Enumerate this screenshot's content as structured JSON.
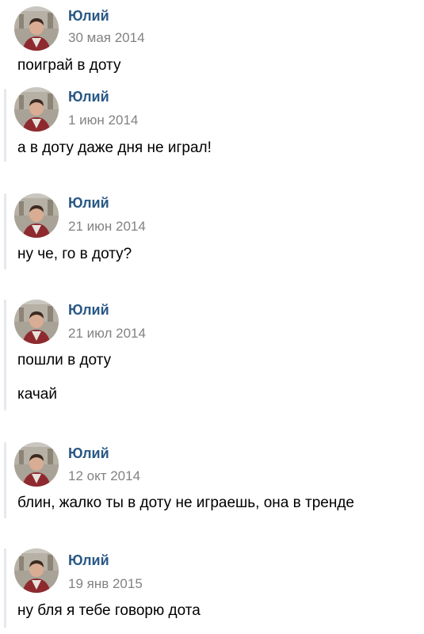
{
  "messages": [
    {
      "author": "Юлий",
      "date": "30 мая 2014",
      "lines": [
        "поиграй в доту"
      ]
    },
    {
      "author": "Юлий",
      "date": "1 июн 2014",
      "lines": [
        "а в доту даже дня не играл!"
      ]
    },
    {
      "author": "Юлий",
      "date": "21 июн 2014",
      "lines": [
        "ну че, го в доту?"
      ]
    },
    {
      "author": "Юлий",
      "date": "21 июл 2014",
      "lines": [
        "пошли в доту",
        "качай"
      ]
    },
    {
      "author": "Юлий",
      "date": "12 окт 2014",
      "lines": [
        "блин, жалко ты в доту не играешь, она в тренде"
      ]
    },
    {
      "author": "Юлий",
      "date": "19 янв 2015",
      "lines": [
        "ну бля я тебе говорю дота"
      ]
    }
  ],
  "colors": {
    "author": "#2a5885",
    "date": "#828282",
    "text": "#000000",
    "bar": "#e5e8ec"
  },
  "icons": {
    "avatar": "user-photo"
  }
}
